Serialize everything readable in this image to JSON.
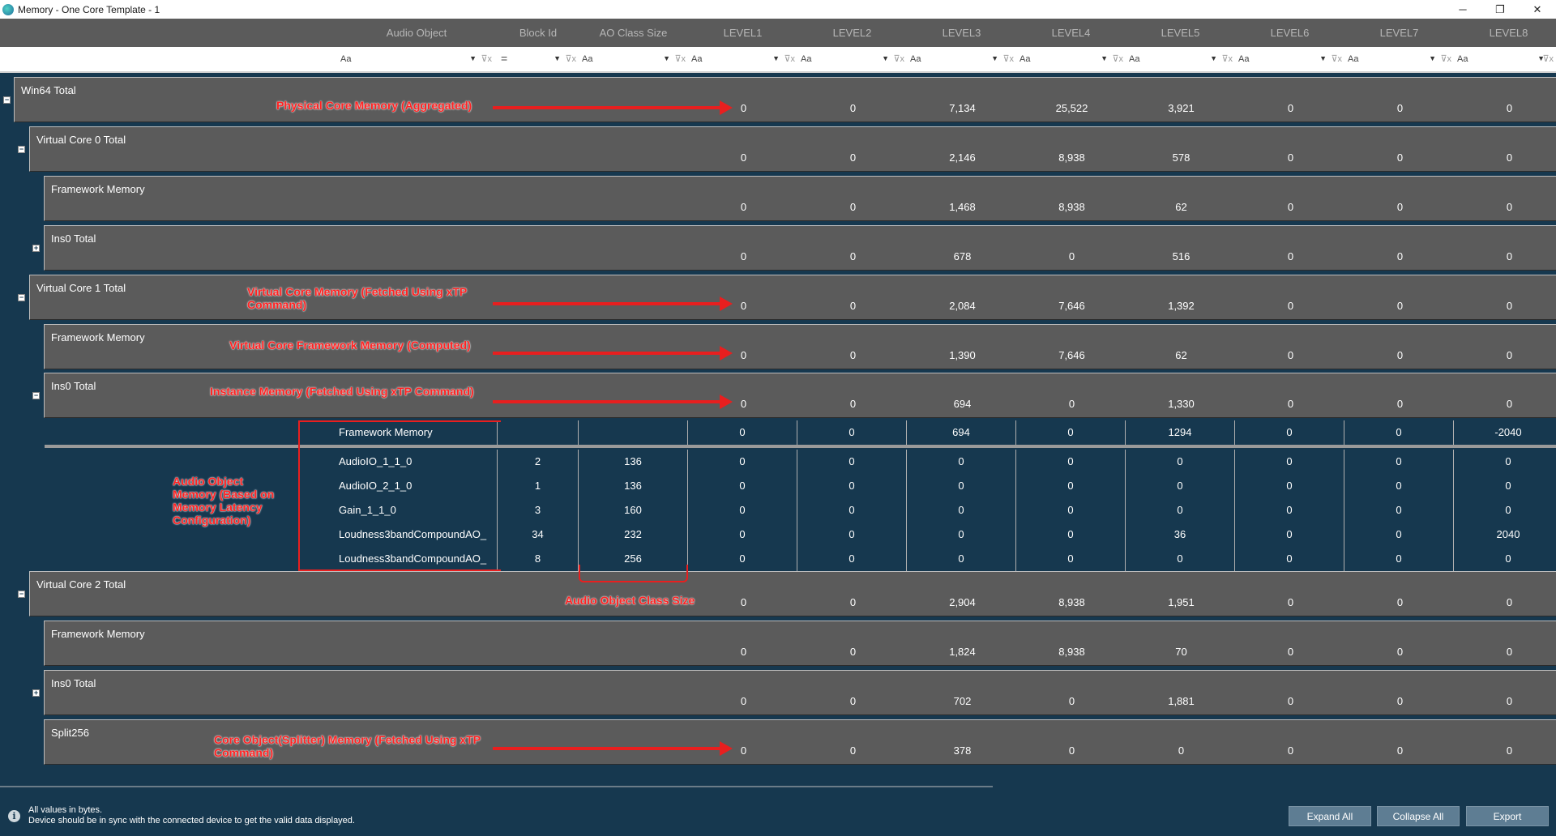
{
  "window": {
    "title": "Memory - One Core Template - 1",
    "controls": [
      "─",
      "❐",
      "✕"
    ]
  },
  "columns": {
    "audio_object": "Audio Object",
    "block_id": "Block Id",
    "ao_class_size": "AO Class Size",
    "levels": [
      "LEVEL1",
      "LEVEL2",
      "LEVEL3",
      "LEVEL4",
      "LEVEL5",
      "LEVEL6",
      "LEVEL7",
      "LEVEL8"
    ]
  },
  "filters": {
    "text_filter_icon": "Aa",
    "equals_filter_icon": "=",
    "clear_filter_icon": "⊽x"
  },
  "rows": [
    {
      "label": "Win64 Total",
      "toggle": "−",
      "values": [
        "0",
        "0",
        "7,134",
        "25,522",
        "3,921",
        "0",
        "0",
        "0"
      ]
    },
    {
      "label": "Virtual Core 0 Total",
      "toggle": "−",
      "values": [
        "0",
        "0",
        "2,146",
        "8,938",
        "578",
        "0",
        "0",
        "0"
      ]
    },
    {
      "label": "Framework Memory",
      "toggle": "",
      "values": [
        "0",
        "0",
        "1,468",
        "8,938",
        "62",
        "0",
        "0",
        "0"
      ]
    },
    {
      "label": "Ins0 Total",
      "toggle": "+",
      "values": [
        "0",
        "0",
        "678",
        "0",
        "516",
        "0",
        "0",
        "0"
      ]
    },
    {
      "label": "Virtual Core 1 Total",
      "toggle": "−",
      "values": [
        "0",
        "0",
        "2,084",
        "7,646",
        "1,392",
        "0",
        "0",
        "0"
      ]
    },
    {
      "label": "Framework Memory",
      "toggle": "",
      "values": [
        "0",
        "0",
        "1,390",
        "7,646",
        "62",
        "0",
        "0",
        "0"
      ]
    },
    {
      "label": "Ins0 Total",
      "toggle": "−",
      "values": [
        "0",
        "0",
        "694",
        "0",
        "1,330",
        "0",
        "0",
        "0"
      ]
    },
    {
      "label": "Virtual Core 2 Total",
      "toggle": "−",
      "values": [
        "0",
        "0",
        "2,904",
        "8,938",
        "1,951",
        "0",
        "0",
        "0"
      ]
    },
    {
      "label": "Framework Memory",
      "toggle": "",
      "values": [
        "0",
        "0",
        "1,824",
        "8,938",
        "70",
        "0",
        "0",
        "0"
      ]
    },
    {
      "label": "Ins0 Total",
      "toggle": "+",
      "values": [
        "0",
        "0",
        "702",
        "0",
        "1,881",
        "0",
        "0",
        "0"
      ]
    },
    {
      "label": "Split256",
      "toggle": "",
      "values": [
        "0",
        "0",
        "378",
        "0",
        "0",
        "0",
        "0",
        "0"
      ]
    }
  ],
  "ao_table": {
    "framework": {
      "name": "Framework Memory",
      "block_id": "",
      "class_size": "",
      "values": [
        "0",
        "0",
        "694",
        "0",
        "1294",
        "0",
        "0",
        "-2040"
      ]
    },
    "objects": [
      {
        "name": "AudioIO_1_1_0",
        "block_id": "2",
        "class_size": "136",
        "values": [
          "0",
          "0",
          "0",
          "0",
          "0",
          "0",
          "0",
          "0"
        ]
      },
      {
        "name": "AudioIO_2_1_0",
        "block_id": "1",
        "class_size": "136",
        "values": [
          "0",
          "0",
          "0",
          "0",
          "0",
          "0",
          "0",
          "0"
        ]
      },
      {
        "name": "Gain_1_1_0",
        "block_id": "3",
        "class_size": "160",
        "values": [
          "0",
          "0",
          "0",
          "0",
          "0",
          "0",
          "0",
          "0"
        ]
      },
      {
        "name": "Loudness3bandCompoundAO_",
        "block_id": "34",
        "class_size": "232",
        "values": [
          "0",
          "0",
          "0",
          "0",
          "36",
          "0",
          "0",
          "2040"
        ]
      },
      {
        "name": "Loudness3bandCompoundAO_",
        "block_id": "8",
        "class_size": "256",
        "values": [
          "0",
          "0",
          "0",
          "0",
          "0",
          "0",
          "0",
          "0"
        ]
      }
    ]
  },
  "annotations": {
    "physical": "Physical Core Memory (Aggregated)",
    "virtual": "Virtual Core Memory (Fetched Using xTP Command)",
    "vc_framework": "Virtual Core Framework Memory (Computed)",
    "instance": "Instance Memory (Fetched Using xTP Command)",
    "audio_object": "Audio Object Memory (Based on Memory Latency Configuration)",
    "class_size": "Audio Object Class Size",
    "core_object": "Core Object(Splitter) Memory (Fetched Using xTP Command)"
  },
  "footer": {
    "line1": "All values in bytes.",
    "line2": "Device should be in sync with the connected device to get the valid data displayed.",
    "expand_all": "Expand All",
    "collapse_all": "Collapse All",
    "export": "Export"
  }
}
